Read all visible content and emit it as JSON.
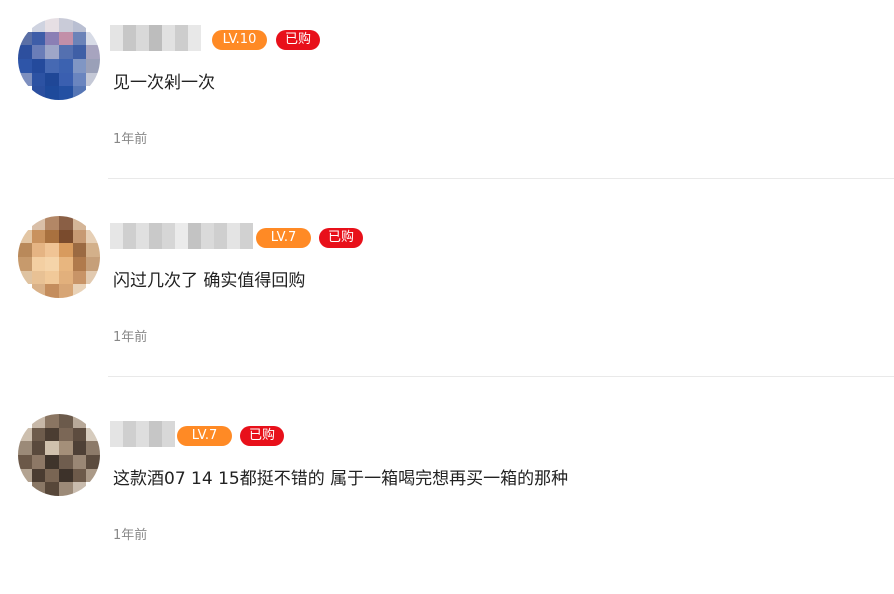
{
  "comments": [
    {
      "level": "LV.10",
      "purchased": "已购",
      "text": "见一次剁一次",
      "time": "1年前"
    },
    {
      "level": "LV.7",
      "purchased": "已购",
      "text": "闪过几次了 确实值得回购",
      "time": "1年前"
    },
    {
      "level": "LV.7",
      "purchased": "已购",
      "text": "这款酒07 14 15都挺不错的 属于一箱喝完想再买一箱的那种",
      "time": "1年前"
    }
  ],
  "colors": {
    "level_badge": "#ff8a25",
    "purchased_badge": "#e8101a",
    "divider": "#e9e9e9"
  }
}
